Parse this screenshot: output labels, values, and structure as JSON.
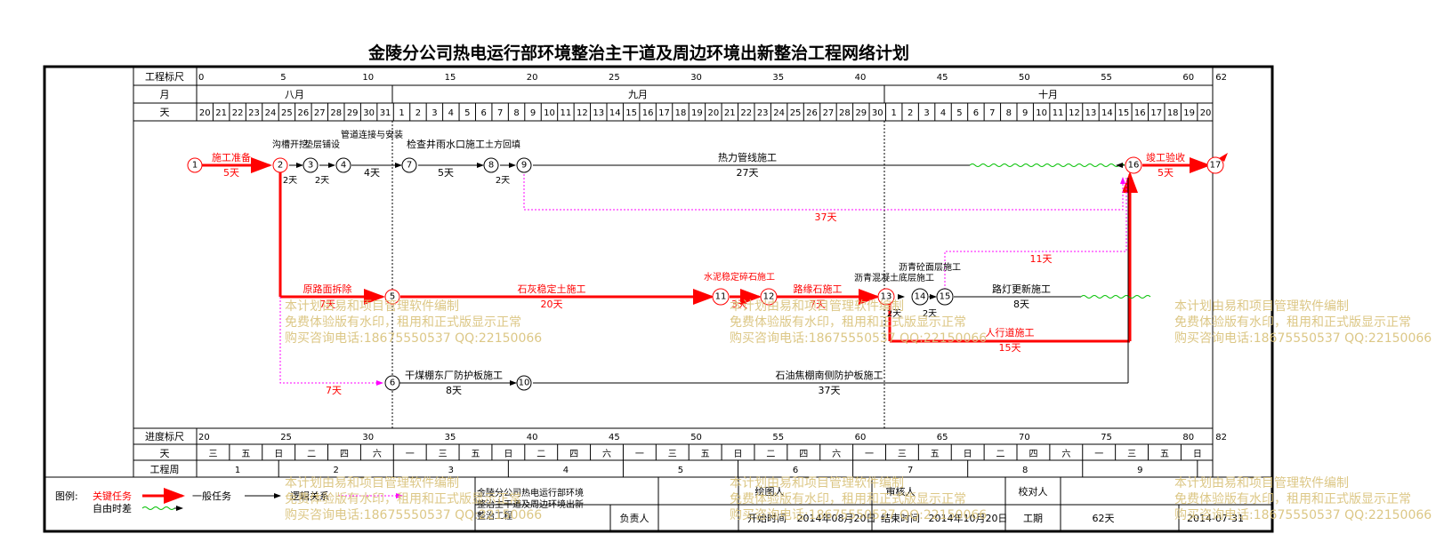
{
  "title": "金陵分公司热电运行部环境整治主干道及周边环境出新整治工程网络计划",
  "scale_top": {
    "label_scale": "工程标尺",
    "label_month": "月",
    "label_day": "天",
    "ticks": [
      "0",
      "5",
      "10",
      "15",
      "20",
      "25",
      "30",
      "35",
      "40",
      "45",
      "50",
      "55",
      "60",
      "62"
    ],
    "months": [
      "八月",
      "九月",
      "十月"
    ],
    "days": [
      "20",
      "21",
      "22",
      "23",
      "24",
      "25",
      "26",
      "27",
      "28",
      "29",
      "30",
      "31",
      "1",
      "2",
      "3",
      "4",
      "5",
      "6",
      "7",
      "8",
      "9",
      "10",
      "11",
      "12",
      "13",
      "14",
      "15",
      "16",
      "17",
      "18",
      "19",
      "20",
      "21",
      "22",
      "23",
      "24",
      "25",
      "26",
      "27",
      "28",
      "29",
      "30",
      "1",
      "2",
      "3",
      "4",
      "5",
      "6",
      "7",
      "8",
      "9",
      "10",
      "11",
      "12",
      "13",
      "14",
      "15",
      "16",
      "17",
      "18",
      "19",
      "20"
    ]
  },
  "scale_bottom": {
    "label_progress": "进度标尺",
    "label_day": "天",
    "label_week": "工程周",
    "ticks": [
      "20",
      "25",
      "30",
      "35",
      "40",
      "45",
      "50",
      "55",
      "60",
      "65",
      "70",
      "75",
      "80",
      "82"
    ],
    "weekdays": [
      "三",
      "五",
      "日",
      "二",
      "四",
      "六",
      "一",
      "三",
      "五",
      "日",
      "二",
      "四",
      "六",
      "一",
      "三",
      "五",
      "日",
      "二",
      "四",
      "六",
      "一",
      "三",
      "五",
      "日",
      "二",
      "四",
      "六",
      "一",
      "三",
      "五",
      "日"
    ],
    "weeks": [
      "1",
      "2",
      "3",
      "4",
      "5",
      "6",
      "7",
      "8",
      "9"
    ]
  },
  "nodes": [
    "1",
    "2",
    "3",
    "4",
    "5",
    "6",
    "7",
    "8",
    "9",
    "10",
    "11",
    "12",
    "13",
    "14",
    "15",
    "16",
    "17"
  ],
  "tasks": {
    "t1_name": "施工准备",
    "t1_dur": "5天",
    "t2_name": "沟槽开挖",
    "t2_dur": "2天",
    "t3_name": "垫层铺设",
    "t3_dur": "2天",
    "t4_name": "管道连接与安装",
    "t4_dur": "4天",
    "t5_name": "检查井雨水口施工",
    "t5_dur": "5天",
    "t6_name": "土方回填",
    "t6_dur": "2天",
    "t7_name": "热力管线施工",
    "t7_dur": "27天",
    "t8_name": "竣工验收",
    "t8_dur": "5天",
    "t9_dur": "37天",
    "t10_name": "原路面拆除",
    "t10_dur": "7天",
    "t11_name": "石灰稳定土施工",
    "t11_dur": "20天",
    "t12_name": "水泥稳定碎石施工",
    "t12_dur": "3天",
    "t13_name": "路缘石施工",
    "t13_dur": "7天",
    "t14_name": "沥青混凝土底层施工",
    "t14_dur": "2天",
    "t14b_name": "沥青砼面层施工",
    "t14b_dur": "2天",
    "t15_name": "路灯更新施工",
    "t15_dur": "8天",
    "t16_dur": "11天",
    "t17_name": "人行道施工",
    "t17_dur": "15天",
    "t18_name": "干煤棚东厂防护板施工",
    "t18_dur": "8天",
    "t19_dur": "7天",
    "t20_name": "石油焦棚南侧防护板施工",
    "t20_dur": "37天"
  },
  "watermark": {
    "line1": "本计划由易和项目管理软件编制",
    "line2": "免费体验版有水印，租用和正式版显示正常",
    "line3": "购买咨询电话:18675550537 QQ:22150066"
  },
  "legend": {
    "label": "图例:",
    "critical": "关键任务",
    "general": "一般任务",
    "logic": "逻辑关系",
    "free_float": "自由时差"
  },
  "footer": {
    "project_name": "金陵分公司热电运行部环境整治主干道及周边环境出新整治工程",
    "drawer": "绘图人",
    "reviewer": "审核人",
    "checker": "校对人",
    "responsible": "负责人",
    "start_label": "开始时间",
    "start_value": "2014年08月20日",
    "end_label": "结束时间",
    "end_value": "2014年10月20日",
    "duration_label": "工期",
    "duration_value": "62天",
    "date_value": "2014-07-31"
  },
  "colors": {
    "critical": "#ff0000",
    "normal": "#000000",
    "float": "#00c000",
    "logic": "#ff00ff",
    "watermark": "#d9c27a"
  }
}
